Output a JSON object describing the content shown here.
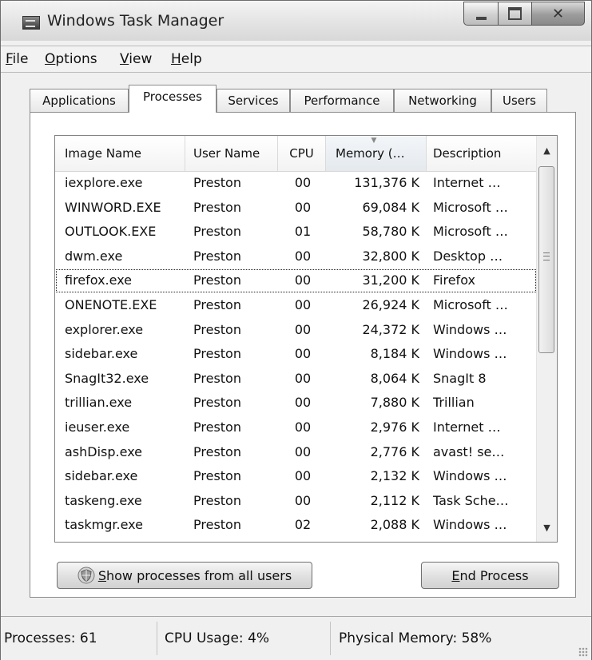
{
  "window": {
    "title": "Windows Task Manager"
  },
  "menu": [
    "File",
    "Options",
    "View",
    "Help"
  ],
  "tabs": [
    "Applications",
    "Processes",
    "Services",
    "Performance",
    "Networking",
    "Users"
  ],
  "active_tab": "Processes",
  "columns": [
    "Image Name",
    "User Name",
    "CPU",
    "Memory (…",
    "Description"
  ],
  "processes": [
    {
      "name": "iexplore.exe",
      "user": "Preston",
      "cpu": "00",
      "memory": "131,376 K",
      "description": "Internet …"
    },
    {
      "name": "WINWORD.EXE",
      "user": "Preston",
      "cpu": "00",
      "memory": "69,084 K",
      "description": "Microsoft …"
    },
    {
      "name": "OUTLOOK.EXE",
      "user": "Preston",
      "cpu": "01",
      "memory": "58,780 K",
      "description": "Microsoft …"
    },
    {
      "name": "dwm.exe",
      "user": "Preston",
      "cpu": "00",
      "memory": "32,800 K",
      "description": "Desktop …"
    },
    {
      "name": "firefox.exe",
      "user": "Preston",
      "cpu": "00",
      "memory": "31,200 K",
      "description": "Firefox"
    },
    {
      "name": "ONENOTE.EXE",
      "user": "Preston",
      "cpu": "00",
      "memory": "26,924 K",
      "description": "Microsoft …"
    },
    {
      "name": "explorer.exe",
      "user": "Preston",
      "cpu": "00",
      "memory": "24,372 K",
      "description": "Windows …"
    },
    {
      "name": "sidebar.exe",
      "user": "Preston",
      "cpu": "00",
      "memory": "8,184 K",
      "description": "Windows …"
    },
    {
      "name": "SnagIt32.exe",
      "user": "Preston",
      "cpu": "00",
      "memory": "8,064 K",
      "description": "SnagIt 8"
    },
    {
      "name": "trillian.exe",
      "user": "Preston",
      "cpu": "00",
      "memory": "7,880 K",
      "description": "Trillian"
    },
    {
      "name": "ieuser.exe",
      "user": "Preston",
      "cpu": "00",
      "memory": "2,976 K",
      "description": "Internet …"
    },
    {
      "name": "ashDisp.exe",
      "user": "Preston",
      "cpu": "00",
      "memory": "2,776 K",
      "description": "avast! se…"
    },
    {
      "name": "sidebar.exe",
      "user": "Preston",
      "cpu": "00",
      "memory": "2,132 K",
      "description": "Windows …"
    },
    {
      "name": "taskeng.exe",
      "user": "Preston",
      "cpu": "00",
      "memory": "2,112 K",
      "description": "Task Sche…"
    },
    {
      "name": "taskmgr.exe",
      "user": "Preston",
      "cpu": "02",
      "memory": "2,088 K",
      "description": "Windows …"
    }
  ],
  "focused_process": "firefox.exe",
  "buttons": {
    "show_all_key": "S",
    "show_all_rest": "how processes from all users",
    "end_key": "E",
    "end_rest": "nd Process"
  },
  "status": {
    "processes": "Processes: 61",
    "cpu": "CPU Usage: 4%",
    "memory": "Physical Memory: 58%"
  },
  "icons": {
    "app": "task-manager-icon",
    "shield": "uac-shield-icon",
    "minimize": "minimize-icon",
    "maximize": "maximize-icon",
    "close": "close-icon"
  }
}
